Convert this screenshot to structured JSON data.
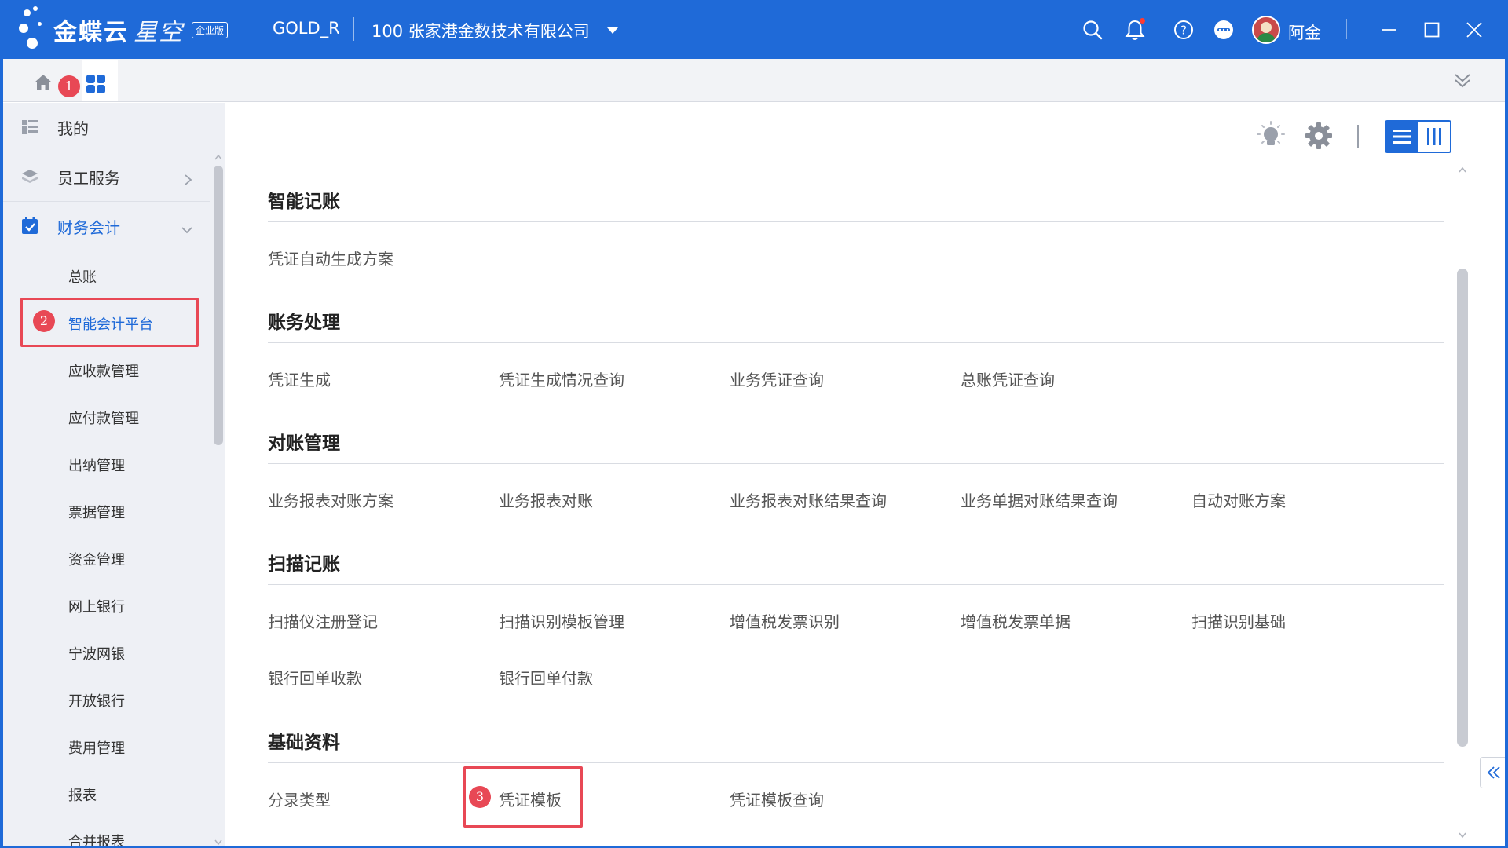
{
  "titlebar": {
    "brand": "金蝶云",
    "brand_star": "星空",
    "edition_badge": "企业版",
    "user_code": "GOLD_R",
    "org": "100  张家港金数技术有限公司",
    "username": "阿金",
    "icons": [
      "search-icon",
      "bell-icon",
      "help-icon",
      "more-icon",
      "avatar",
      "minimize-icon",
      "maximize-icon",
      "close-icon"
    ]
  },
  "tabs": {
    "home_icon": "home-icon",
    "apps_icon": "apps-grid-icon",
    "callouts": [
      "1",
      "2",
      "3"
    ],
    "collapse_icon": "double-chevron-down-icon"
  },
  "sidebar": {
    "items": [
      {
        "label": "我的",
        "icon": "list-icon"
      },
      {
        "label": "员工服务",
        "icon": "layers-icon"
      },
      {
        "label": "财务会计",
        "icon": "check-calendar-icon"
      }
    ],
    "sub_items": [
      "总账",
      "智能会计平台",
      "应收款管理",
      "应付款管理",
      "出纳管理",
      "票据管理",
      "资金管理",
      "网上银行",
      "宁波网银",
      "开放银行",
      "费用管理",
      "报表",
      "合并报表"
    ]
  },
  "toolbar": {
    "icons": [
      "lightbulb-icon",
      "gear-icon",
      "list-view-icon",
      "column-view-icon"
    ]
  },
  "sections": [
    {
      "title": "智能记账",
      "links": [
        "凭证自动生成方案"
      ]
    },
    {
      "title": "账务处理",
      "links": [
        "凭证生成",
        "凭证生成情况查询",
        "业务凭证查询",
        "总账凭证查询"
      ]
    },
    {
      "title": "对账管理",
      "links": [
        "业务报表对账方案",
        "业务报表对账",
        "业务报表对账结果查询",
        "业务单据对账结果查询",
        "自动对账方案"
      ]
    },
    {
      "title": "扫描记账",
      "links": [
        "扫描仪注册登记",
        "扫描识别模板管理",
        "增值税发票识别",
        "增值税发票单据",
        "扫描识别基础",
        "银行回单收款",
        "银行回单付款"
      ]
    },
    {
      "title": "基础资料",
      "links": [
        "分录类型",
        "凭证模板",
        "凭证模板查询"
      ]
    }
  ],
  "colors": {
    "brand_blue": "#1f6ad8",
    "callout_red": "#e84855"
  }
}
